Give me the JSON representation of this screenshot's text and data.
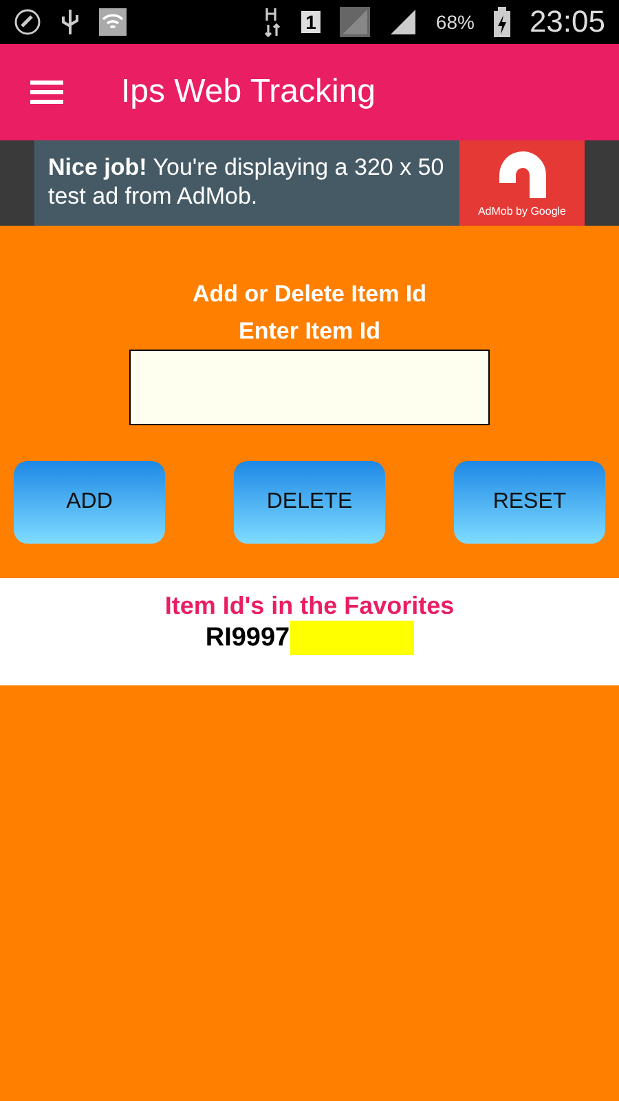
{
  "status_bar": {
    "battery": "68%",
    "time": "23:05",
    "network": "1"
  },
  "app_bar": {
    "title": "Ips Web Tracking"
  },
  "ad": {
    "text": "**Nice job!** You're displaying a 320 x 50 test ad from AdMob.",
    "brand": "AdMob by Google"
  },
  "form": {
    "heading": "Add or Delete Item Id",
    "label": "Enter Item Id",
    "buttons": [
      "ADD",
      "DELETE",
      "RESET"
    ]
  },
  "favorites": {
    "heading": "Item Id's in the Favorites",
    "items": [
      {
        "id": "RI9997",
        "redacted": true
      }
    ]
  }
}
